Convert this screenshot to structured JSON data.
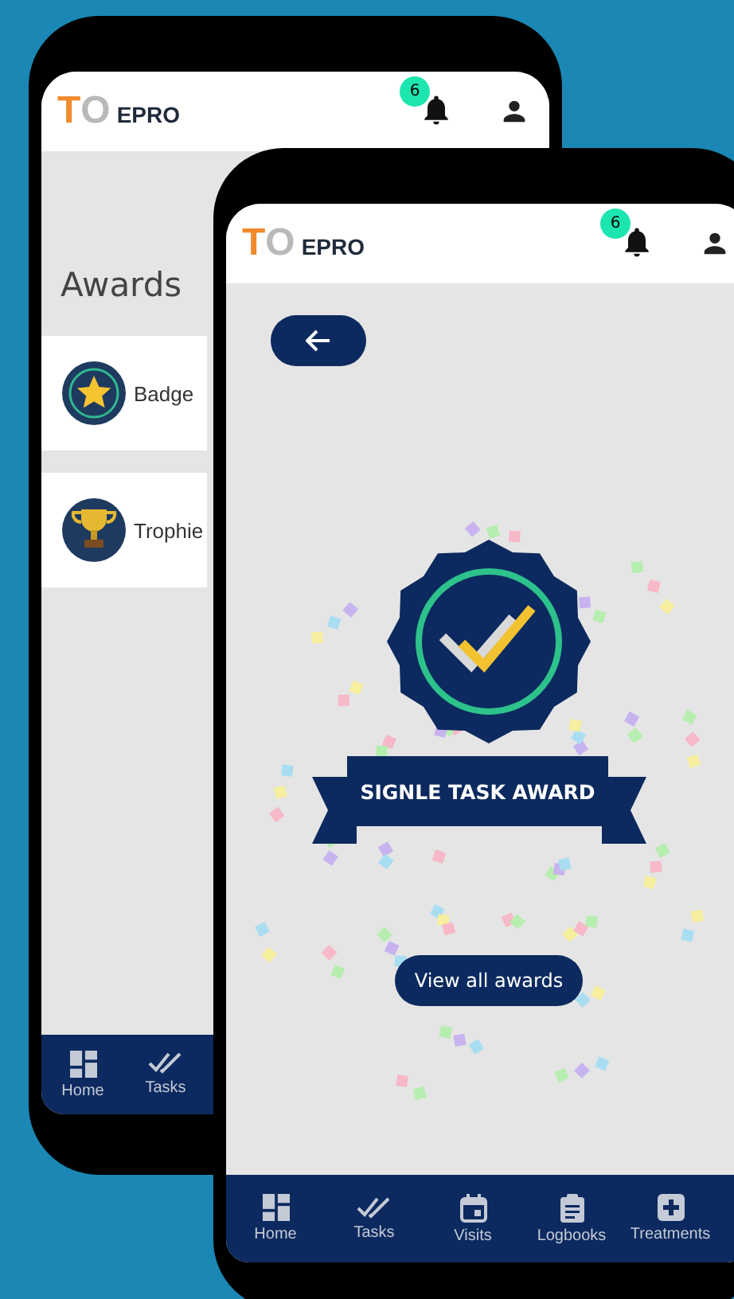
{
  "back_phone": {
    "logo": [
      {
        "kind": "t",
        "text": "T"
      },
      {
        "kind": "o",
        "text": "O"
      },
      {
        "kind": "name",
        "text": "EPRO"
      }
    ],
    "notification_count": "6",
    "title": "Awards",
    "items": [
      {
        "kind": "badge",
        "label": "Badge"
      },
      {
        "kind": "trophy",
        "label": "Trophie"
      }
    ],
    "nav": [
      {
        "kind": "home",
        "label": "Home"
      },
      {
        "kind": "tasks",
        "label": "Tasks"
      }
    ]
  },
  "front_phone": {
    "logo": [
      {
        "kind": "t",
        "text": "T"
      },
      {
        "kind": "o",
        "text": "O"
      },
      {
        "kind": "name",
        "text": "EPRO"
      }
    ],
    "notification_count": "6",
    "award": {
      "title": "SIGNLE TASK AWARD"
    },
    "button": "View all awards",
    "nav": [
      {
        "kind": "home",
        "label": "Home"
      },
      {
        "kind": "tasks",
        "label": "Tasks"
      },
      {
        "kind": "visits",
        "label": "Visits"
      },
      {
        "kind": "logbooks",
        "label": "Logbooks"
      },
      {
        "kind": "treatments",
        "label": "Treatments"
      }
    ]
  }
}
